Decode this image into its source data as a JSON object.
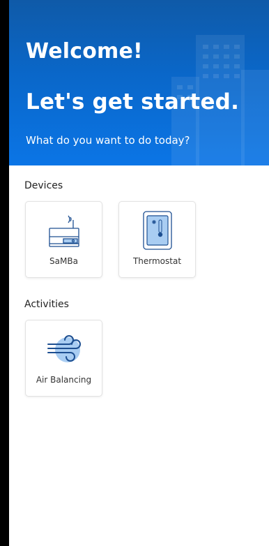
{
  "hero": {
    "title": "Welcome!",
    "subtitle": "Let's get started.",
    "prompt": "What do you want to do today?"
  },
  "sections": {
    "devices": {
      "label": "Devices",
      "items": [
        {
          "label": "SaMBa",
          "icon": "samba-device-icon"
        },
        {
          "label": "Thermostat",
          "icon": "thermostat-icon"
        }
      ]
    },
    "activities": {
      "label": "Activities",
      "items": [
        {
          "label": "Air Balancing",
          "icon": "air-balancing-icon"
        }
      ]
    }
  },
  "colors": {
    "hero_top": "#0f5aa8",
    "hero_bottom": "#0b75e6",
    "icon_blue": "#1d4f91",
    "icon_light_blue": "#a9cdf2"
  }
}
